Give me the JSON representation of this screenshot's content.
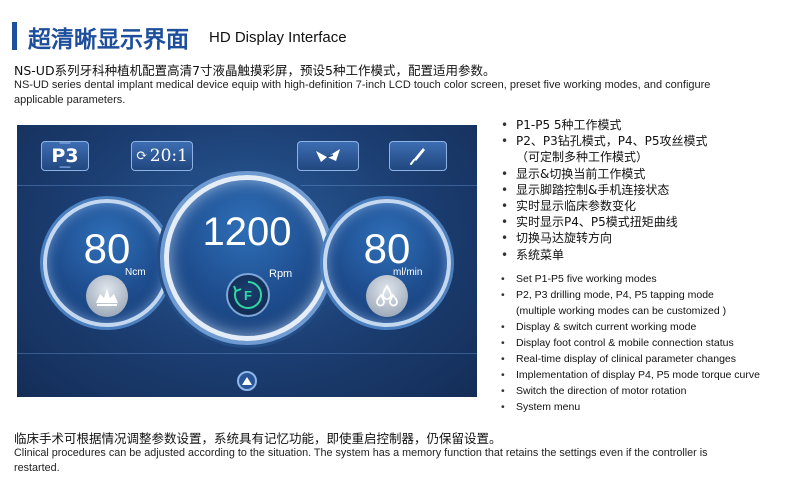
{
  "header": {
    "title_cn": "超清晰显示界面",
    "title_en": "HD Display Interface"
  },
  "intro": {
    "cn": "NS-UD系列牙科种植机配置高清7寸液晶触摸彩屏，预设5种工作模式，配置适用参数。",
    "en": "NS-UD series dental implant medical device equip with high-definition 7-inch LCD touch color screen, preset five working modes, and configure applicable parameters."
  },
  "screen": {
    "mode_button": "P3",
    "ratio_button": "20:1",
    "foot_icon": "foot-pedal-icon",
    "handpiece_icon": "handpiece-icon",
    "left_dial": {
      "value": "80",
      "unit": "Ncm",
      "icon": "torque-icon"
    },
    "center_dial": {
      "value": "1200",
      "unit": "Rpm",
      "icon": "forward-rotation-icon",
      "direction": "F"
    },
    "right_dial": {
      "value": "80",
      "unit": "ml/min",
      "icon": "water-drops-icon"
    },
    "menu_icon": "up-arrow-icon",
    "colors": {
      "panel": "#1b3d71",
      "ring": "#c4d8f0",
      "text": "#ffffff"
    }
  },
  "features_cn": [
    "P1-P5 5种工作模式",
    "P2、P3钻孔模式，P4、P5攻丝模式",
    "（可定制多种工作模式）",
    "显示&切换当前工作模式",
    "显示脚踏控制&手机连接状态",
    "实时显示临床参数变化",
    "实时显示P4、P5模式扭矩曲线",
    "切换马达旋转方向",
    "系统菜单"
  ],
  "features_en": [
    "Set P1-P5 five working modes",
    "P2, P3 drilling mode, P4, P5 tapping mode",
    "(multiple working modes can be customized )",
    "Display & switch current working mode",
    "Display foot control & mobile connection status",
    "Real-time display of clinical parameter changes",
    "Implementation of display P4, P5 mode torque curve",
    "Switch the direction of motor rotation",
    "System menu"
  ],
  "outro": {
    "cn": "临床手术可根据情况调整参数设置，系统具有记忆功能，即使重启控制器，仍保留设置。",
    "en": "Clinical procedures can be adjusted according to the situation. The system has a memory function that retains the settings even if the controller is restarted."
  },
  "accent_color": "#1d4f9c"
}
